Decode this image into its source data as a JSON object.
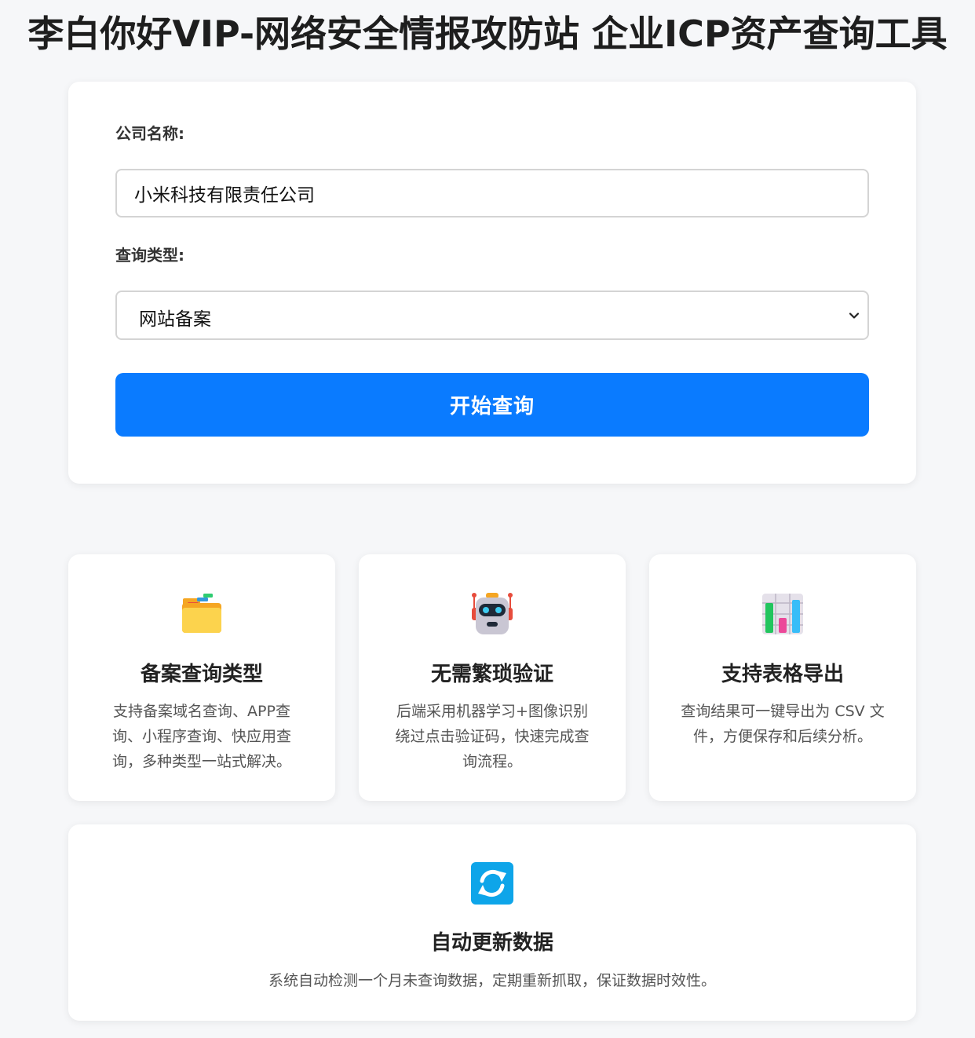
{
  "header": {
    "title": "李白你好VIP-网络安全情报攻防站 企业ICP资产查询工具"
  },
  "form": {
    "company_label": "公司名称:",
    "company_value": "小米科技有限责任公司",
    "type_label": "查询类型:",
    "type_selected": "网站备案",
    "submit_label": "开始查询"
  },
  "features": [
    {
      "icon": "folder-icon",
      "title": "备案查询类型",
      "desc": "支持备案域名查询、APP查询、小程序查询、快应用查询，多种类型一站式解决。"
    },
    {
      "icon": "robot-icon",
      "title": "无需繁琐验证",
      "desc": "后端采用机器学习+图像识别绕过点击验证码，快速完成查询流程。"
    },
    {
      "icon": "bar-chart-icon",
      "title": "支持表格导出",
      "desc": "查询结果可一键导出为 CSV 文件，方便保存和后续分析。"
    },
    {
      "icon": "refresh-icon",
      "title": "自动更新数据",
      "desc": "系统自动检测一个月未查询数据，定期重新抓取，保证数据时效性。"
    }
  ],
  "colors": {
    "accent": "#0a7bff",
    "background": "#f6f7f9"
  }
}
